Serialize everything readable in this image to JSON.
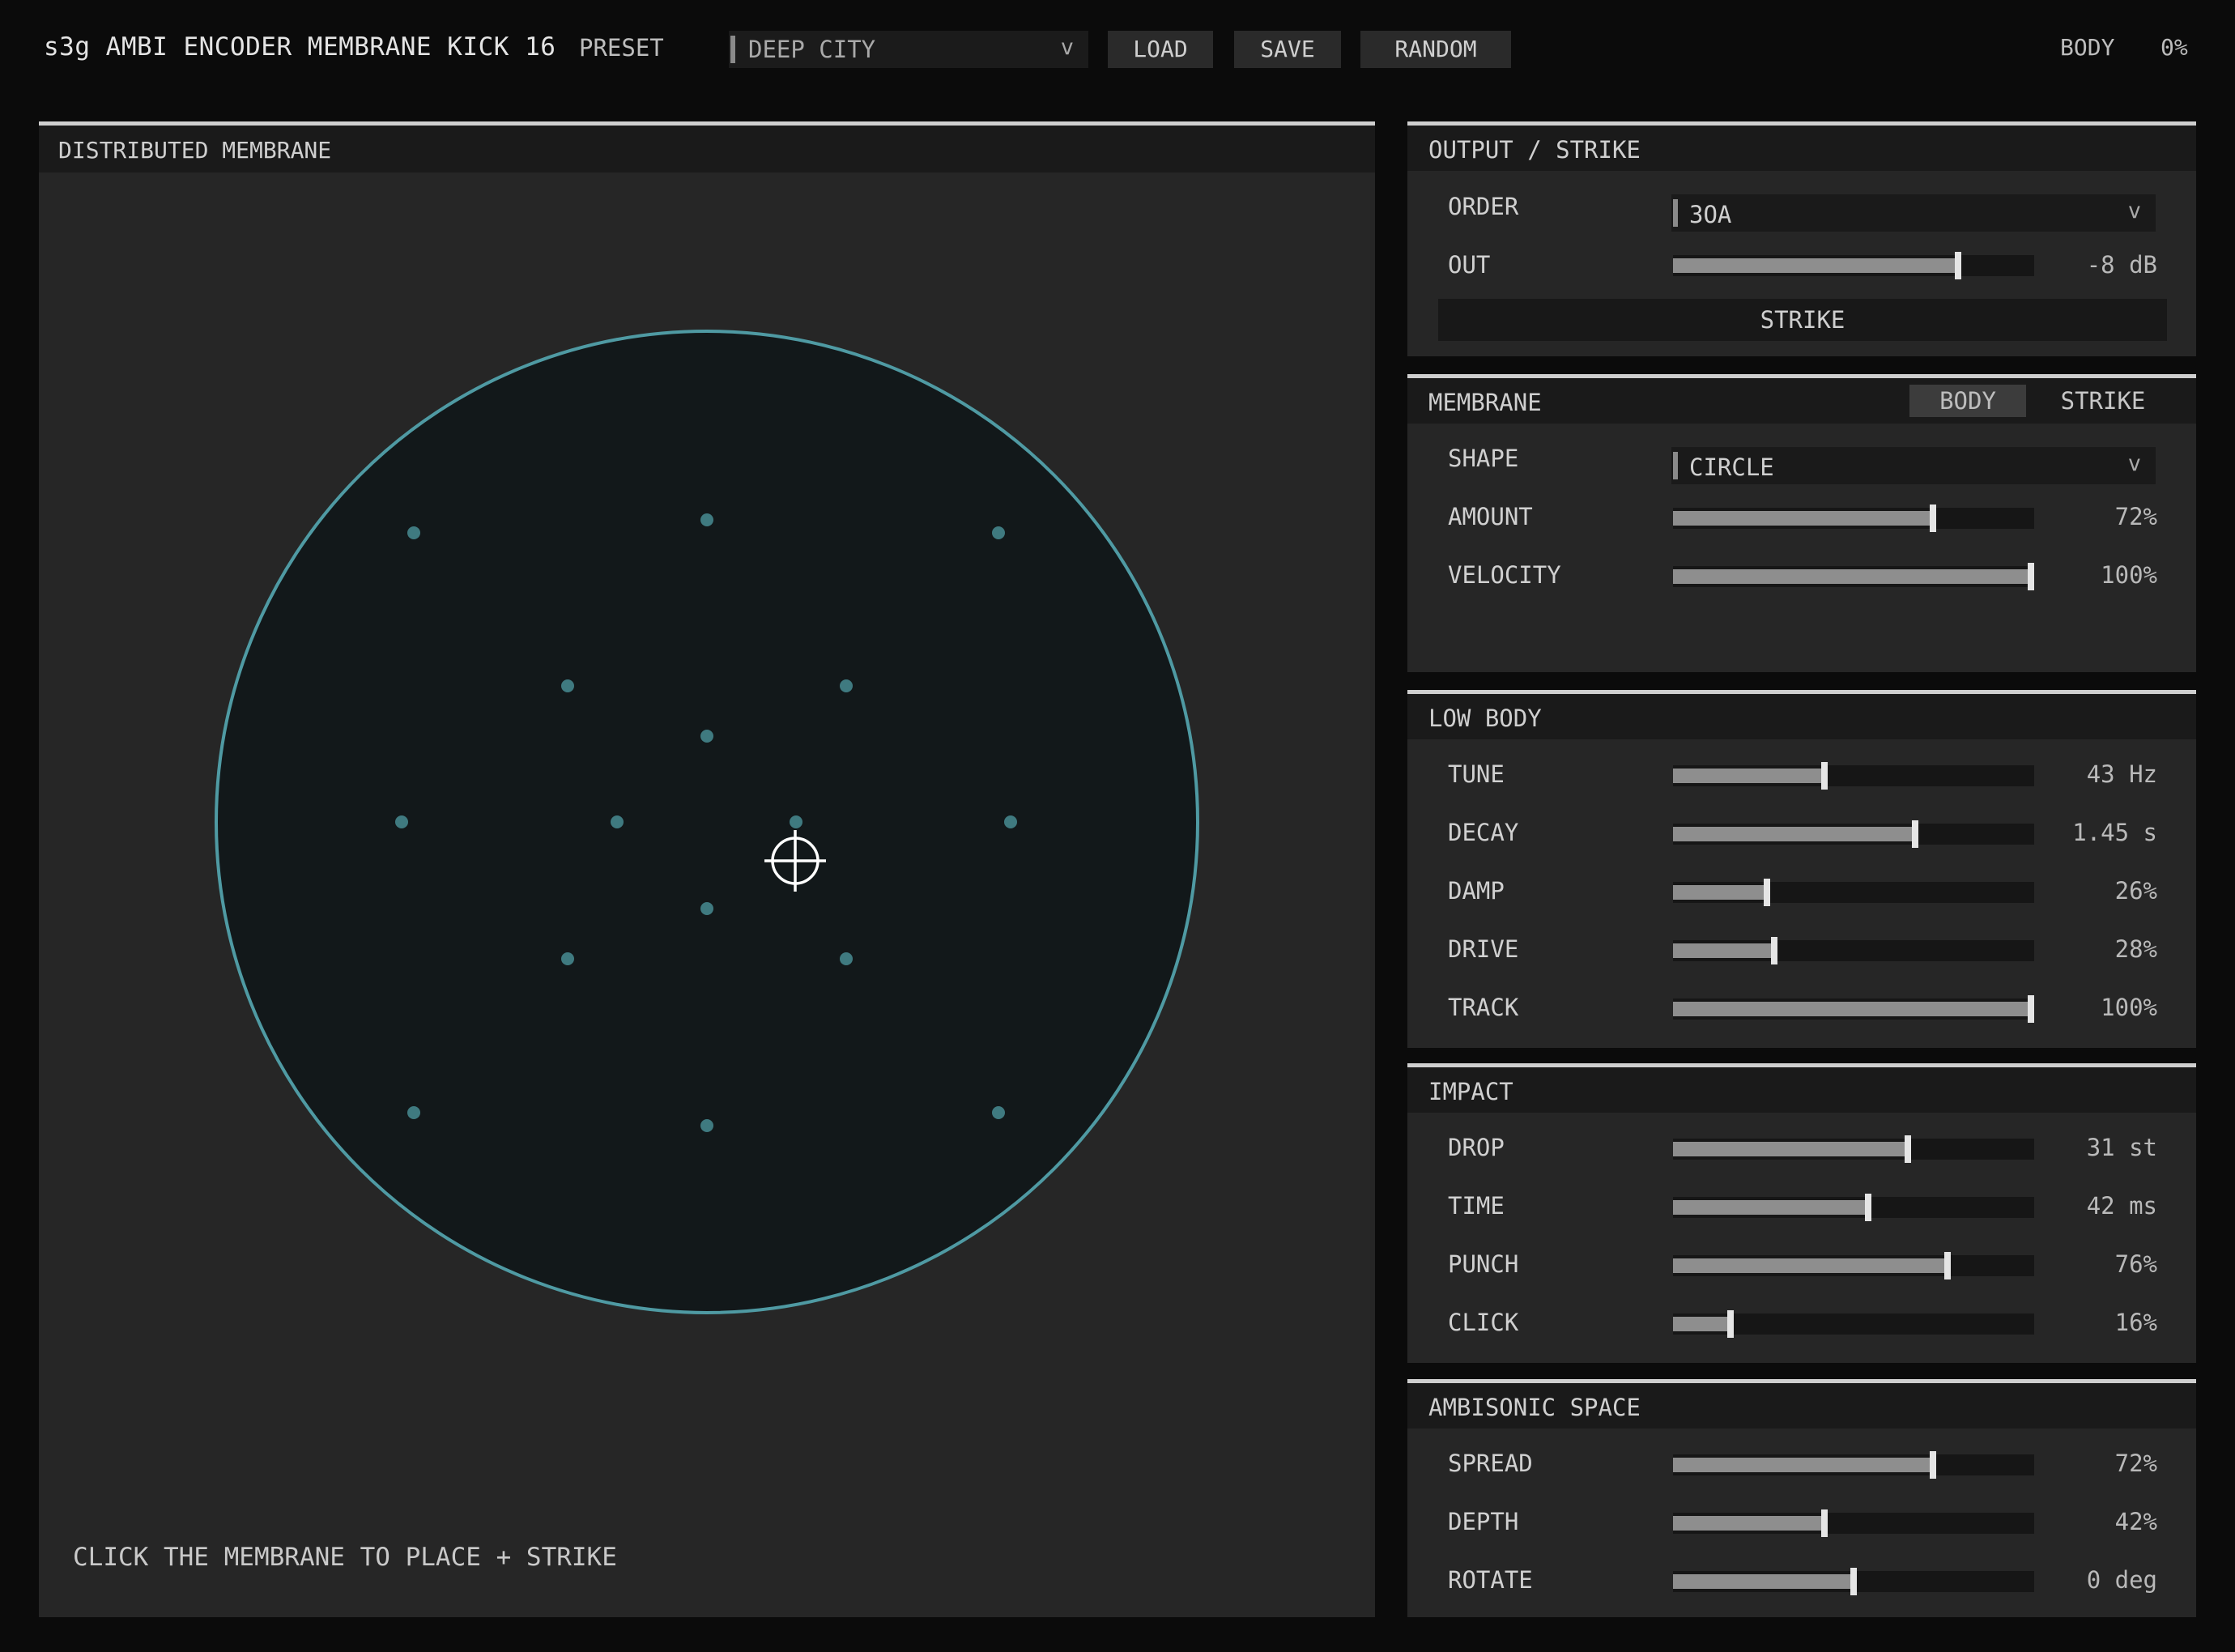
{
  "header": {
    "title": "s3g AMBI ENCODER MEMBRANE KICK 16",
    "preset_label": "PRESET",
    "preset_value": "DEEP CITY",
    "chevron": "v",
    "load_label": "LOAD",
    "save_label": "SAVE",
    "random_label": "RANDOM",
    "body_label": "BODY",
    "body_value": "0%"
  },
  "membrane_panel": {
    "title": "DISTRIBUTED MEMBRANE",
    "hint": "CLICK THE MEMBRANE TO PLACE + STRIKE",
    "ring_color": "#4f9aa3",
    "dot_color": "#3f7a80",
    "fill_color": "#12181a",
    "crosshair_icon": "crosshair-icon"
  },
  "output_strike": {
    "title": "OUTPUT / STRIKE",
    "order_label": "ORDER",
    "order_value": "3OA",
    "out_label": "OUT",
    "out_value": "-8 dB",
    "out_level": 0.79,
    "strike_label": "STRIKE"
  },
  "membrane": {
    "title": "MEMBRANE",
    "toggle_body": "BODY",
    "toggle_strike": "STRIKE",
    "active_toggle": "BODY",
    "shape_label": "SHAPE",
    "shape_value": "CIRCLE",
    "amount_label": "AMOUNT",
    "amount_value": "72%",
    "amount_level": 0.72,
    "velocity_label": "VELOCITY",
    "velocity_value": "100%",
    "velocity_level": 1.0
  },
  "low_body": {
    "title": "LOW BODY",
    "rows": [
      {
        "label": "TUNE",
        "value": "43 Hz",
        "level": 0.42
      },
      {
        "label": "DECAY",
        "value": "1.45 s",
        "level": 0.67
      },
      {
        "label": "DAMP",
        "value": "26%",
        "level": 0.26
      },
      {
        "label": "DRIVE",
        "value": "28%",
        "level": 0.28
      },
      {
        "label": "TRACK",
        "value": "100%",
        "level": 1.0
      }
    ]
  },
  "impact": {
    "title": "IMPACT",
    "rows": [
      {
        "label": "DROP",
        "value": "31 st",
        "level": 0.65
      },
      {
        "label": "TIME",
        "value": "42 ms",
        "level": 0.54
      },
      {
        "label": "PUNCH",
        "value": "76%",
        "level": 0.76
      },
      {
        "label": "CLICK",
        "value": "16%",
        "level": 0.16
      }
    ]
  },
  "ambisonic_space": {
    "title": "AMBISONIC SPACE",
    "rows": [
      {
        "label": "SPREAD",
        "value": "72%",
        "level": 0.72
      },
      {
        "label": "DEPTH",
        "value": "42%",
        "level": 0.42
      },
      {
        "label": "ROTATE",
        "value": "0 deg",
        "level": 0.5
      }
    ]
  }
}
